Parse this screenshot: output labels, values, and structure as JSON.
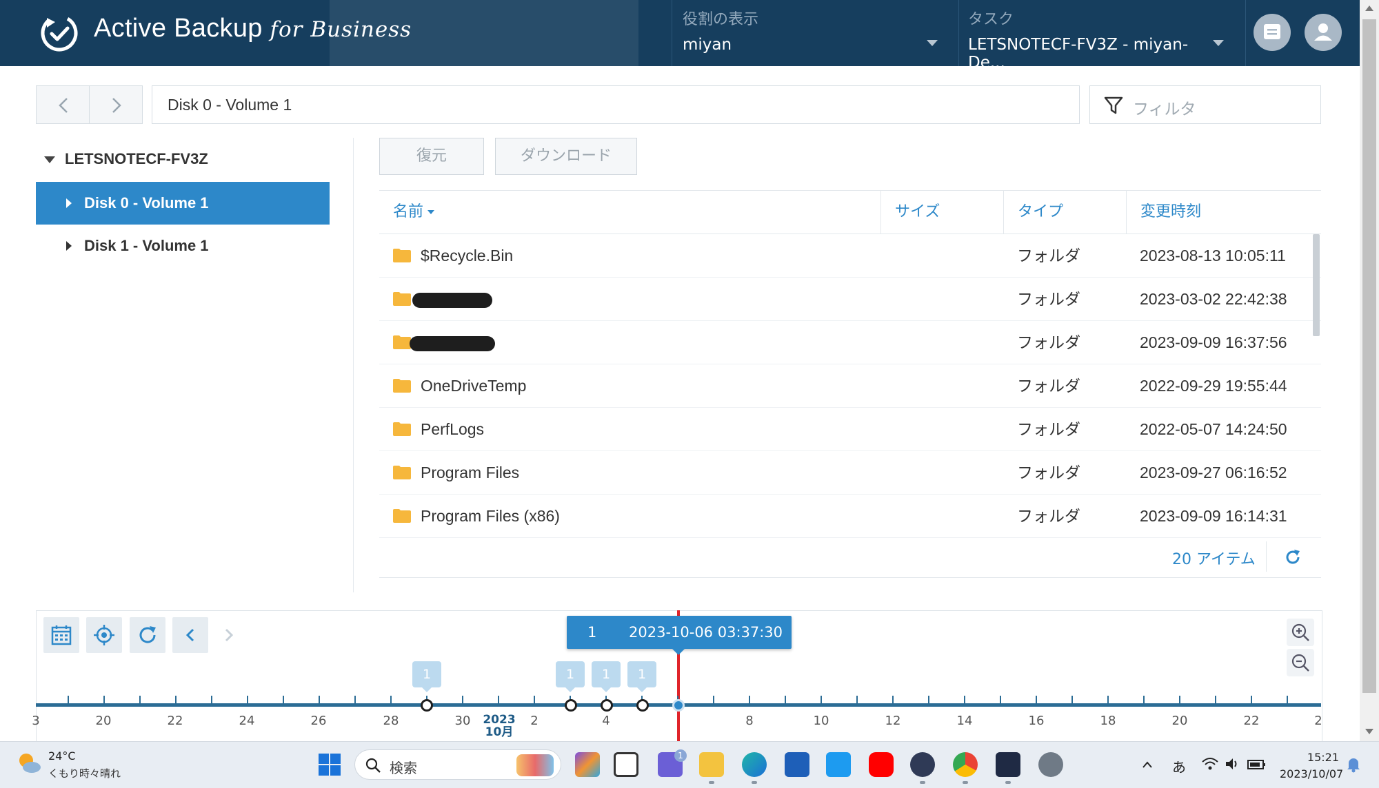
{
  "header": {
    "app_name": "Active Backup",
    "app_suffix": "for Business",
    "role": {
      "label": "役割の表示",
      "value": "miyan"
    },
    "task": {
      "label": "タスク",
      "value": "LETSNOTECF-FV3Z - miyan-De..."
    }
  },
  "toolbar": {
    "path": "Disk 0 - Volume 1",
    "filter_placeholder": "フィルタ"
  },
  "ghost_actions": {
    "restore": "復元",
    "download": "ダウンロード"
  },
  "tree": {
    "root": "LETSNOTECF-FV3Z",
    "items": [
      {
        "label": "Disk 0 - Volume 1",
        "selected": true
      },
      {
        "label": "Disk 1 - Volume 1",
        "selected": false
      }
    ]
  },
  "table": {
    "columns": {
      "name": "名前",
      "size": "サイズ",
      "type": "タイプ",
      "modified": "変更時刻"
    },
    "rows": [
      {
        "name": "$Recycle.Bin",
        "type": "フォルダ",
        "modified": "2023-08-13 10:05:11",
        "redacted": false
      },
      {
        "name": "",
        "type": "フォルダ",
        "modified": "2023-03-02 22:42:38",
        "redacted": true
      },
      {
        "name": "",
        "type": "フォルダ",
        "modified": "2023-09-09 16:37:56",
        "redacted": true
      },
      {
        "name": "OneDriveTemp",
        "type": "フォルダ",
        "modified": "2022-09-29 19:55:44",
        "redacted": false
      },
      {
        "name": "PerfLogs",
        "type": "フォルダ",
        "modified": "2022-05-07 14:24:50",
        "redacted": false
      },
      {
        "name": "Program Files",
        "type": "フォルダ",
        "modified": "2023-09-27 06:16:52",
        "redacted": false
      },
      {
        "name": "Program Files (x86)",
        "type": "フォルダ",
        "modified": "2023-09-09 16:14:31",
        "redacted": false
      }
    ],
    "item_count": "20 アイテム"
  },
  "timeline": {
    "tooltip_count": "1",
    "tooltip_datetime": "2023-10-06 03:37:30",
    "bubbles": [
      "1",
      "1",
      "1",
      "1"
    ],
    "month_year": "2023",
    "month": "10月",
    "ticks": [
      "3",
      "20",
      "22",
      "24",
      "26",
      "28",
      "30",
      "2",
      "4",
      "8",
      "10",
      "12",
      "14",
      "16",
      "18",
      "20",
      "22",
      "2"
    ]
  },
  "taskbar": {
    "temp": "24°C",
    "weather": "くもり時々晴れ",
    "search_placeholder": "検索",
    "ime": "あ",
    "time": "15:21",
    "date": "2023/10/07",
    "chat_badge": "1"
  },
  "colors": {
    "header_bg": "#163e5e",
    "accent": "#2d88c9",
    "marker": "#e0242a",
    "folder": "#f6b73c"
  }
}
